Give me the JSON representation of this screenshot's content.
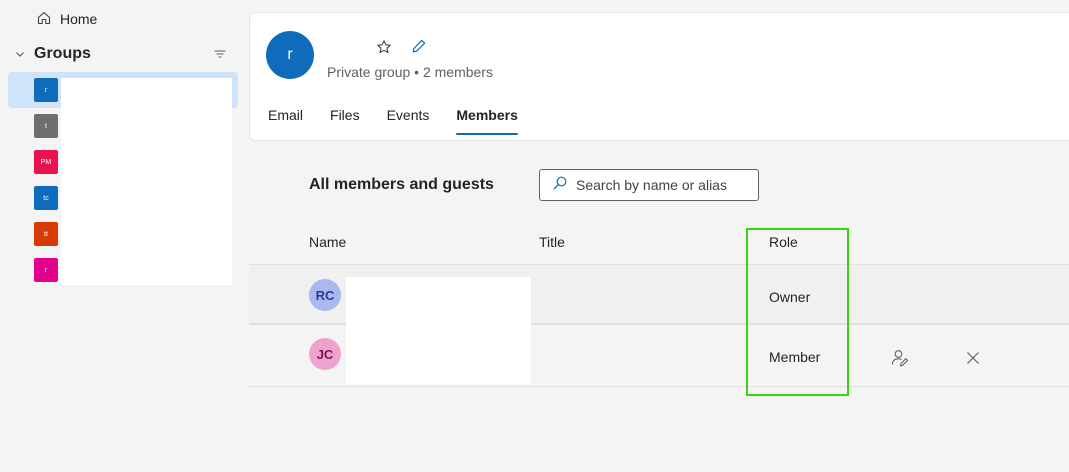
{
  "sidebar": {
    "home_label": "Home",
    "groups_label": "Groups",
    "groups": [
      {
        "initials": "r",
        "color": "#0f6cbd",
        "selected": true
      },
      {
        "initials": "t",
        "color": "#6e6e6e",
        "selected": false
      },
      {
        "initials": "PM",
        "color": "#e8124f",
        "selected": false
      },
      {
        "initials": "tc",
        "color": "#0f6cbd",
        "selected": false
      },
      {
        "initials": "tt",
        "color": "#d83b01",
        "selected": false
      },
      {
        "initials": "r",
        "color": "#e3008c",
        "selected": false
      }
    ]
  },
  "header": {
    "avatar_initial": "r",
    "meta": "Private group • 2 members",
    "tabs": [
      {
        "label": "Email",
        "active": false
      },
      {
        "label": "Files",
        "active": false
      },
      {
        "label": "Events",
        "active": false
      },
      {
        "label": "Members",
        "active": true
      }
    ]
  },
  "members": {
    "section_title": "All members and guests",
    "search_placeholder": "Search by name or alias",
    "columns": {
      "name": "Name",
      "title": "Title",
      "role": "Role"
    },
    "rows": [
      {
        "initials": "RC",
        "role": "Owner",
        "avatar_bg": "#a9b8ee",
        "avatar_fg": "#2b3a8f"
      },
      {
        "initials": "JC",
        "role": "Member",
        "avatar_bg": "#eea3cf",
        "avatar_fg": "#7a1650"
      }
    ]
  },
  "colors": {
    "accent": "#0f6cbd",
    "highlight": "#35d416"
  }
}
